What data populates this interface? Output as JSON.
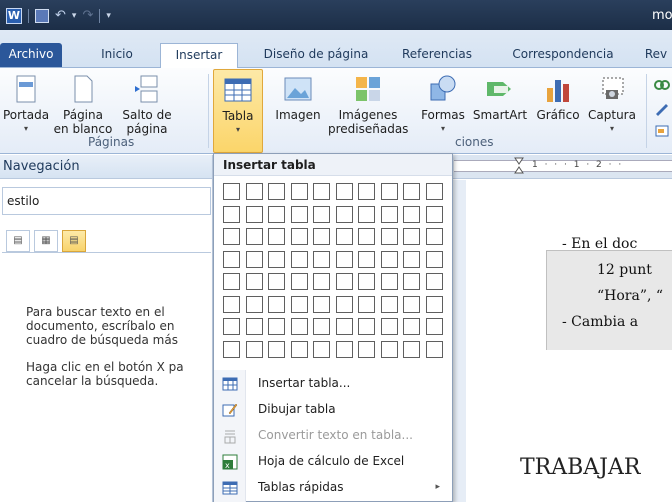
{
  "window": {
    "title": "mo",
    "logo": "W"
  },
  "quick_access": {
    "save": "save-icon",
    "undo": "undo-icon",
    "redo": "redo-icon",
    "dropdown": "▾"
  },
  "tabs": [
    {
      "label": "Archivo"
    },
    {
      "label": "Inicio"
    },
    {
      "label": "Insertar"
    },
    {
      "label": "Diseño de página"
    },
    {
      "label": "Referencias"
    },
    {
      "label": "Correspondencia"
    },
    {
      "label": "Rev"
    }
  ],
  "ribbon": {
    "portada": {
      "line1": "Portada",
      "line2": "▾"
    },
    "pagina_blanco": {
      "line1": "Página",
      "line2": "en blanco"
    },
    "salto_pagina": {
      "line1": "Salto de",
      "line2": "página"
    },
    "group_paginas": "Páginas",
    "tabla": {
      "line1": "Tabla",
      "line2": "▾"
    },
    "imagen": {
      "line1": "Imagen"
    },
    "imagenes_predisenadas": {
      "line1": "Imágenes",
      "line2": "prediseñadas"
    },
    "formas": {
      "line1": "Formas",
      "line2": "▾"
    },
    "smartart": {
      "line1": "SmartArt"
    },
    "grafico": {
      "line1": "Gráfico"
    },
    "captura": {
      "line1": "Captura",
      "line2": "▾"
    },
    "group_ilustraciones": "ciones"
  },
  "nav": {
    "title": "Navegación",
    "search_value": "estilo",
    "help1": [
      "Para buscar texto en el",
      "documento, escríbalo en",
      "cuadro de búsqueda más"
    ],
    "help2": [
      "Haga clic en el botón X pa",
      "cancelar la búsqueda."
    ]
  },
  "ruler": {
    "numbers": "1 · · · 1 · 2 · ·"
  },
  "document": {
    "bullet1_line1": "-     En el doc",
    "bullet1_line2": "12  punt",
    "bullet1_line3": "“Hora”, “",
    "bullet2": "-     Cambia a",
    "heading": "TRABAJAR "
  },
  "table_menu": {
    "header": "Insertar tabla",
    "grid": {
      "cols": 10,
      "rows": 8
    },
    "items": [
      {
        "label": "Insertar tabla...",
        "enabled": true,
        "icon": "table-icon"
      },
      {
        "label": "Dibujar tabla",
        "enabled": true,
        "icon": "pencil-icon"
      },
      {
        "label": "Convertir texto en tabla...",
        "enabled": false,
        "icon": "convert-icon"
      },
      {
        "label": "Hoja de cálculo de Excel",
        "enabled": true,
        "icon": "excel-icon"
      },
      {
        "label": "Tablas rápidas",
        "enabled": true,
        "icon": "quick-tables-icon",
        "submenu": "▸"
      }
    ]
  }
}
